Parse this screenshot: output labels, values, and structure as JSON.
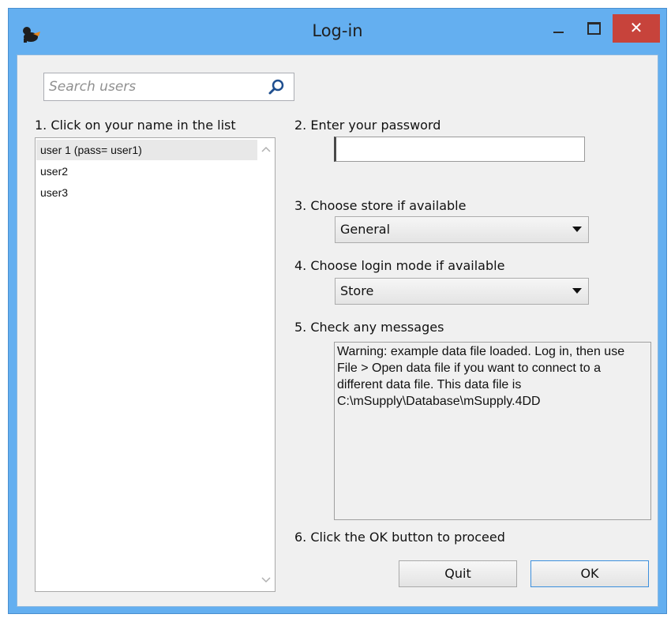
{
  "window": {
    "title": "Log-in",
    "close_glyph": "✕"
  },
  "search": {
    "placeholder": "Search users",
    "value": ""
  },
  "steps": {
    "step1": "1. Click on your name in the list",
    "step2": "2. Enter your password",
    "step3": "3. Choose store if available",
    "step4": "4. Choose login mode if available",
    "step5": "5. Check any messages",
    "step6": "6. Click the OK button to proceed"
  },
  "users": [
    {
      "label": "user 1 (pass= user1)",
      "selected": true
    },
    {
      "label": "user2",
      "selected": false
    },
    {
      "label": "user3",
      "selected": false
    }
  ],
  "store": {
    "selected": "General"
  },
  "login_mode": {
    "selected": "Store"
  },
  "messages": {
    "text": "Warning: example data file loaded. Log in, then use File > Open data file if you want to connect to a different data file. This data file is C:\\mSupply\\Database\\mSupply.4DD"
  },
  "buttons": {
    "quit": "Quit",
    "ok": "OK"
  },
  "icons": {
    "app": "msupply-app-icon",
    "search": "search-icon",
    "minimize": "minimize-icon",
    "maximize": "maximize-icon",
    "close": "close-icon",
    "dropdown": "chevron-down-icon"
  },
  "colors": {
    "title_bar": "#64aff0",
    "close_button": "#c7433b",
    "dialog_bg": "#f0f0f0",
    "ok_border": "#3c8fdd"
  }
}
